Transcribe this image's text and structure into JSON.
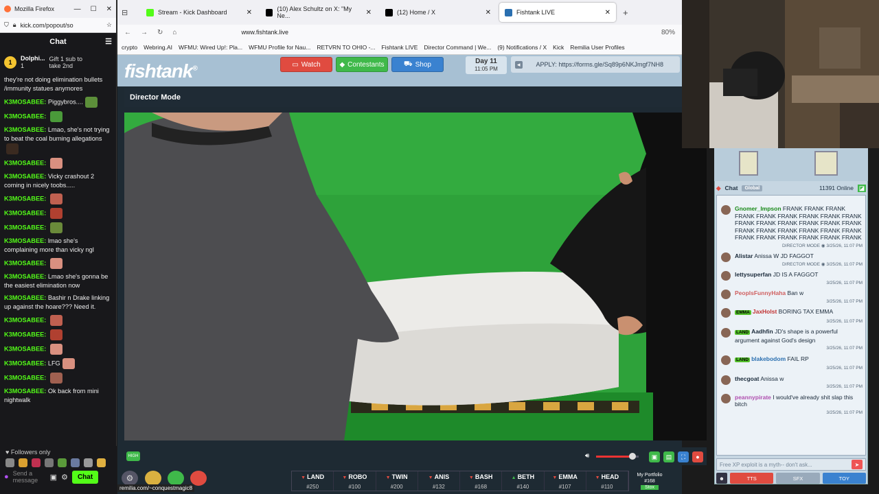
{
  "left_window": {
    "title": "Mozilla Firefox",
    "url": "kick.com/popout/so",
    "chat_title": "Chat",
    "gift_user": "Dolphi...",
    "gift_count": "1",
    "gift_text": "Gift 1 sub to take 2nd",
    "messages": [
      {
        "user": "",
        "text": "they're not doing elimination bullets /immunity statues anymores"
      },
      {
        "user": "K3MOSABEE:",
        "text": "Piggybros....",
        "emote": "#5c8f3a"
      },
      {
        "user": "K3MOSABEE:",
        "text": "",
        "emote": "#4a9a3a"
      },
      {
        "user": "K3MOSABEE:",
        "text": "Lmao, she's not trying to beat the coal burning allegations",
        "emote": "#3a2a20"
      },
      {
        "user": "K3MOSABEE:",
        "text": "",
        "emote": "#d99080"
      },
      {
        "user": "K3MOSABEE:",
        "text": "Vicky crashout 2 coming in nicely toobs.....",
        "emote": ""
      },
      {
        "user": "K3MOSABEE:",
        "text": "",
        "emote": "#c06050"
      },
      {
        "user": "K3MOSABEE:",
        "text": "",
        "emote": "#b04030"
      },
      {
        "user": "K3MOSABEE:",
        "text": "",
        "emote": "#6a8a3a"
      },
      {
        "user": "K3MOSABEE:",
        "text": "lmao she's complaining more than vicky ngl",
        "emote": ""
      },
      {
        "user": "K3MOSABEE:",
        "text": "",
        "emote": "#d99080"
      },
      {
        "user": "K3MOSABEE:",
        "text": "Lmao she's gonna be the easiest elimination now",
        "emote": ""
      },
      {
        "user": "K3MOSABEE:",
        "text": "Bashir n Drake linking up against the hoare??? Need it.",
        "emote": ""
      },
      {
        "user": "K3MOSABEE:",
        "text": "",
        "emote": "#c06050"
      },
      {
        "user": "K3MOSABEE:",
        "text": "",
        "emote": "#b04030"
      },
      {
        "user": "K3MOSABEE:",
        "text": "",
        "emote": "#d99080"
      },
      {
        "user": "K3MOSABEE:",
        "text": "LFG",
        "emote": "#d99080"
      },
      {
        "user": "K3MOSABEE:",
        "text": "",
        "emote": "#a06050"
      },
      {
        "user": "K3MOSABEE:",
        "text": "Ok back from mini nightwalk",
        "emote": ""
      }
    ],
    "followers_only": "Followers only",
    "send_placeholder": "Send a message",
    "chat_button": "Chat"
  },
  "tabs": [
    {
      "label": "Stream - Kick Dashboard",
      "color": "#53fc18"
    },
    {
      "label": "(10) Alex Schultz on X: \"My Ne...",
      "color": "#000000"
    },
    {
      "label": "(12) Home / X",
      "color": "#000000"
    },
    {
      "label": "Fishtank LIVE",
      "color": "#2a6fb0"
    }
  ],
  "nav": {
    "address": "www.fishtank.live",
    "zoom": "80%"
  },
  "bookmarks": [
    "crypto",
    "Webring.AI",
    "WFMU: Wired Up!: Pla...",
    "WFMU Profile for Nau...",
    "RETVRN TO OHIO -...",
    "Fishtank LIVE",
    "Director Command | We...",
    "(9) Notifications / X",
    "Kick",
    "Remilia User Profiles"
  ],
  "fishtank": {
    "logo": "fishtank",
    "logo_mark": "®",
    "buttons": {
      "watch": "Watch",
      "contestants": "Contestants",
      "shop": "Shop"
    },
    "day": "Day 11",
    "time": "11:05 PM",
    "apply": "APPLY: https://forms.gle/Sq89p6NKJmgf7NH8",
    "director_mode": "Director Mode",
    "quality": "HIGH",
    "volume_level": 0.85,
    "status_url": "remilia.com/~conquestmagic8",
    "contestants": [
      {
        "name": "LAND",
        "code": "#250",
        "dir": "▼"
      },
      {
        "name": "ROBO",
        "code": "#100",
        "dir": "▼"
      },
      {
        "name": "TWIN",
        "code": "#200",
        "dir": "▼"
      },
      {
        "name": "ANIS",
        "code": "#132",
        "dir": "▼"
      },
      {
        "name": "BASH",
        "code": "#168",
        "dir": "▼"
      },
      {
        "name": "BETH",
        "code": "#140",
        "dir": "▲"
      },
      {
        "name": "EMMA",
        "code": "#107",
        "dir": "▼"
      },
      {
        "name": "HEAD",
        "code": "#110",
        "dir": "▼"
      }
    ],
    "portfolio": {
      "label": "My Portfolio",
      "value": "#168",
      "stock": "Stox"
    }
  },
  "right_chat": {
    "title": "Chat",
    "global": "Global",
    "online": "11391 Online",
    "messages": [
      {
        "user": "Gnomer_Impson",
        "ucolor": "#1a8a1a",
        "text": "FRANK FRANK FRANK FRANK FRANK FRANK FRANK FRANK FRANK FRANK FRANK FRANK FRANK FRANK FRANK FRANK FRANK FRANK FRANK FRANK FRANK FRANK FRANK FRANK FRANK FRANK FRANK",
        "ts": "DIRECTOR MODE ◉ 3/25/26, 11:07 PM",
        "tag": ""
      },
      {
        "user": "Alistar",
        "ucolor": "#1a2a3a",
        "text": "Anissa W JD FAGGOT",
        "ts": "DIRECTOR MODE ◉ 3/25/26, 11:07 PM",
        "tag": ""
      },
      {
        "user": "lettysuperfan",
        "ucolor": "#1a2a3a",
        "text": "JD IS A FAGGOT",
        "ts": "3/25/26, 11:07 PM",
        "tag": ""
      },
      {
        "user": "PeoplsFunnyHaha",
        "ucolor": "#d06060",
        "text": "Ban w",
        "ts": "3/25/26, 11:07 PM",
        "tag": ""
      },
      {
        "user": "JaxHolst",
        "ucolor": "#c03030",
        "text": "BORING TAX EMMA",
        "ts": "3/25/26, 11:07 PM",
        "tag": "EMMA"
      },
      {
        "user": "Aadhfin",
        "ucolor": "#1a2a3a",
        "text": "JD's shape is a powerful argument against God's design",
        "ts": "3/25/26, 11:07 PM",
        "tag": "LAND"
      },
      {
        "user": "blakebodom",
        "ucolor": "#2a6fb0",
        "text": "FAIL RP",
        "ts": "3/25/26, 11:07 PM",
        "tag": "LAND"
      },
      {
        "user": "thecgoat",
        "ucolor": "#1a2a3a",
        "text": "Anissa w",
        "ts": "3/25/26, 11:07 PM",
        "tag": ""
      },
      {
        "user": "peannypirate",
        "ucolor": "#b050b0",
        "text": "I would've already shit slap this bitch",
        "ts": "3/25/26, 11:07 PM",
        "tag": ""
      }
    ],
    "input_placeholder": "Free XP exploit is a myth-- don't ask...",
    "buttons": {
      "tts": "TTS",
      "sfx": "SFX",
      "toy": "TOY"
    }
  }
}
